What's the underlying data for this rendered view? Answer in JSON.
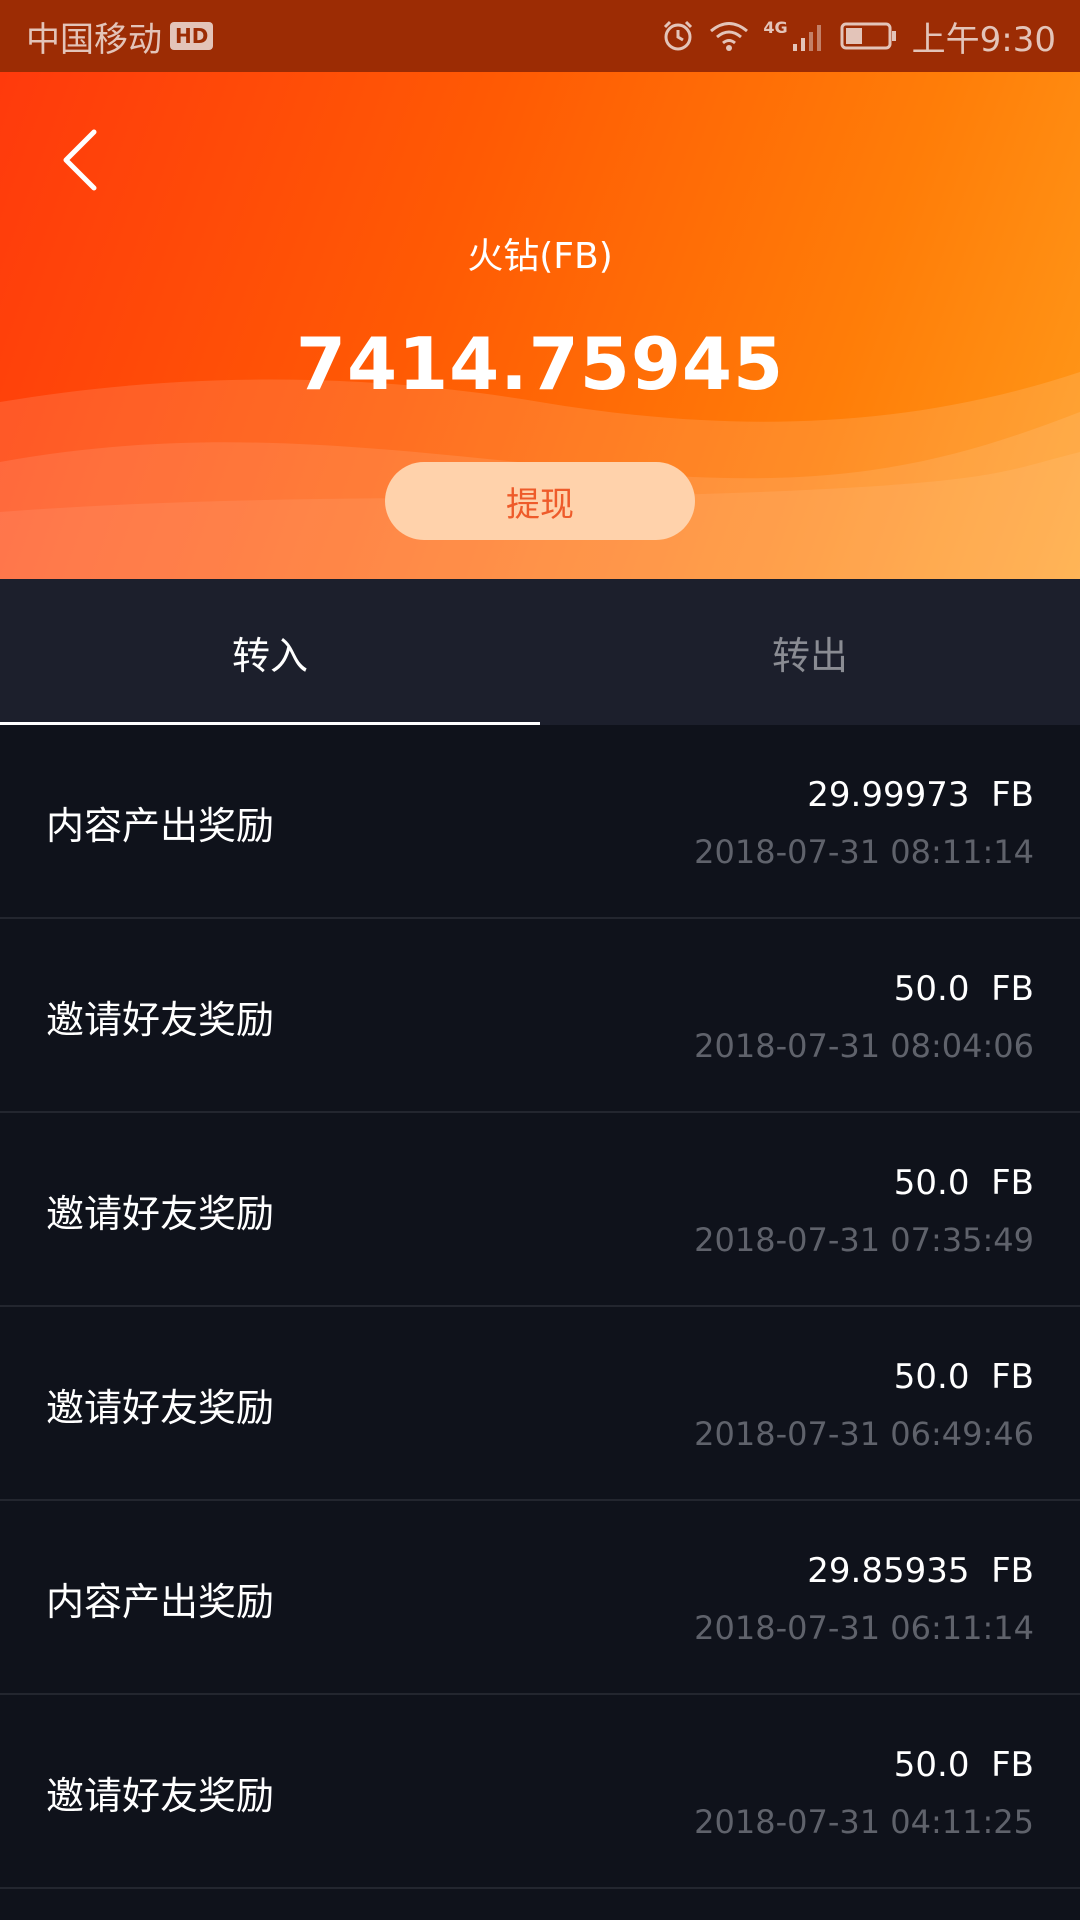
{
  "status_bar": {
    "carrier": "中国移动",
    "hd": "HD",
    "network": "4G",
    "time": "上午9:30"
  },
  "header": {
    "title": "火钻(FB)",
    "balance": "7414.75945",
    "withdraw_label": "提现"
  },
  "tabs": [
    {
      "label": "转入",
      "active": true
    },
    {
      "label": "转出",
      "active": false
    }
  ],
  "unit": "FB",
  "records": [
    {
      "label": "内容产出奖励",
      "amount": "29.99973",
      "time": "2018-07-31 08:11:14"
    },
    {
      "label": "邀请好友奖励",
      "amount": "50.0",
      "time": "2018-07-31 08:04:06"
    },
    {
      "label": "邀请好友奖励",
      "amount": "50.0",
      "time": "2018-07-31 07:35:49"
    },
    {
      "label": "邀请好友奖励",
      "amount": "50.0",
      "time": "2018-07-31 06:49:46"
    },
    {
      "label": "内容产出奖励",
      "amount": "29.85935",
      "time": "2018-07-31 06:11:14"
    },
    {
      "label": "邀请好友奖励",
      "amount": "50.0",
      "time": "2018-07-31 04:11:25"
    }
  ]
}
